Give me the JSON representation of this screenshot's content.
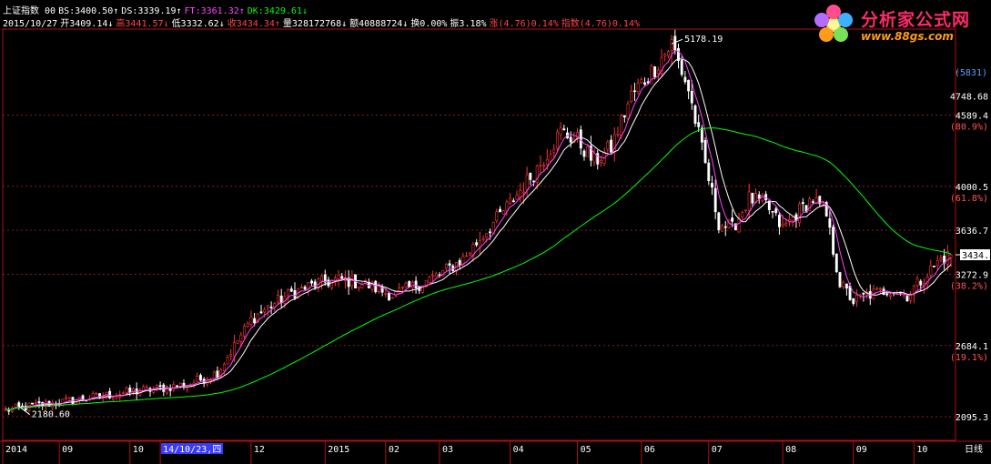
{
  "header": {
    "line1": [
      {
        "label": "上证指数 00",
        "value": "",
        "color": "#ffffff"
      },
      {
        "label": "BS:",
        "value": "3400.50↑",
        "color": "#ffffff"
      },
      {
        "label": "DS:",
        "value": "3339.19↑",
        "color": "#ffffff"
      },
      {
        "label": "FT:",
        "value": "3361.32↑",
        "color": "#ff44ff"
      },
      {
        "label": "DK:",
        "value": "3429.61↓",
        "color": "#00ff00"
      }
    ],
    "line2": [
      {
        "label": "2015/10/27",
        "value": "",
        "color": "#ffffff"
      },
      {
        "label": "开",
        "value": "3409.14↓",
        "color": "#ffffff"
      },
      {
        "label": "高",
        "value": "3441.57↓",
        "color": "#ff4444"
      },
      {
        "label": "低",
        "value": "3332.62↓",
        "color": "#ffffff"
      },
      {
        "label": "收",
        "value": "3434.34↑",
        "color": "#ff4444"
      },
      {
        "label": "量",
        "value": "328172768↓",
        "color": "#ffffff"
      },
      {
        "label": "额",
        "value": "40888724↓",
        "color": "#ffffff"
      },
      {
        "label": "换",
        "value": "0.00%",
        "color": "#ffffff"
      },
      {
        "label": "振",
        "value": "3.18%",
        "color": "#ffffff"
      },
      {
        "label": "涨",
        "value": "(4.76)0.14%",
        "color": "#ff4444"
      },
      {
        "label": "指数",
        "value": "(4.76)0.14%",
        "color": "#ff4444"
      }
    ]
  },
  "logo": {
    "title": "分析家公式网",
    "url": "www.88gs.com"
  },
  "colors": {
    "background": "#000000",
    "frame": "#b01010",
    "grid": "#8b1a1a",
    "candle_up": "#ff3333",
    "candle_down": "#ffffff",
    "ma_fast": "#ffffff",
    "ma_mid": "#ff44ff",
    "ma_long": "#00ff00",
    "axis_text": "#ffffff",
    "percent_text": "#ff5555",
    "highlight_box": "#3a3aff"
  },
  "chart_data": {
    "type": "line",
    "title": "",
    "series_note": "上证指数 daily candlesticks with moving averages",
    "xlabel": "",
    "ylabel": "",
    "ylim": [
      1900,
      5300
    ],
    "grid": true,
    "y_ticks": [
      {
        "value": 5831,
        "label": "(5831)",
        "percent": ""
      },
      {
        "value": 4748.68,
        "label": "4748.68",
        "percent": ""
      },
      {
        "value": 4589.4,
        "label": "4589.4",
        "percent": "(80.9%)"
      },
      {
        "value": 4000.5,
        "label": "4000.5",
        "percent": "(61.8%)"
      },
      {
        "value": 3636.7,
        "label": "3636.7",
        "percent": ""
      },
      {
        "value": 3272.9,
        "label": "3272.9",
        "percent": "(38.2%)"
      },
      {
        "value": 2684.1,
        "label": "2684.1",
        "percent": "(19.1%)"
      },
      {
        "value": 2095.3,
        "label": "2095.3",
        "percent": ""
      }
    ],
    "current_price_label": "3434.3",
    "current_price": 3434.34,
    "x_ticks": [
      {
        "label": "2014",
        "index": 0
      },
      {
        "label": "09",
        "index": 16
      },
      {
        "label": "10",
        "index": 37
      },
      {
        "label": "14/10/23,四",
        "index": 46,
        "highlight": true
      },
      {
        "label": "12",
        "index": 73
      },
      {
        "label": "2015",
        "index": 95
      },
      {
        "label": "02",
        "index": 113
      },
      {
        "label": "03",
        "index": 129
      },
      {
        "label": "04",
        "index": 150
      },
      {
        "label": "05",
        "index": 170
      },
      {
        "label": "06",
        "index": 189
      },
      {
        "label": "07",
        "index": 209
      },
      {
        "label": "08",
        "index": 231
      },
      {
        "label": "09",
        "index": 252
      },
      {
        "label": "10",
        "index": 270
      }
    ],
    "x_end_label": "日线",
    "n_bars": 282,
    "anchors": [
      [
        0,
        2150
      ],
      [
        12,
        2200
      ],
      [
        22,
        2240
      ],
      [
        37,
        2300
      ],
      [
        46,
        2330
      ],
      [
        55,
        2370
      ],
      [
        63,
        2460
      ],
      [
        68,
        2680
      ],
      [
        73,
        2900
      ],
      [
        78,
        3000
      ],
      [
        85,
        3120
      ],
      [
        93,
        3200
      ],
      [
        100,
        3230
      ],
      [
        108,
        3180
      ],
      [
        115,
        3100
      ],
      [
        122,
        3180
      ],
      [
        129,
        3270
      ],
      [
        136,
        3400
      ],
      [
        142,
        3600
      ],
      [
        150,
        3860
      ],
      [
        158,
        4150
      ],
      [
        165,
        4450
      ],
      [
        170,
        4380
      ],
      [
        175,
        4200
      ],
      [
        180,
        4320
      ],
      [
        186,
        4750
      ],
      [
        192,
        4950
      ],
      [
        198,
        5178
      ],
      [
        203,
        4800
      ],
      [
        207,
        4300
      ],
      [
        212,
        3700
      ],
      [
        216,
        3650
      ],
      [
        221,
        3900
      ],
      [
        226,
        3850
      ],
      [
        231,
        3650
      ],
      [
        236,
        3800
      ],
      [
        240,
        3900
      ],
      [
        244,
        3750
      ],
      [
        248,
        3200
      ],
      [
        252,
        3050
      ],
      [
        256,
        3100
      ],
      [
        263,
        3150
      ],
      [
        268,
        3100
      ],
      [
        273,
        3250
      ],
      [
        278,
        3400
      ],
      [
        281,
        3434
      ]
    ],
    "annotations": [
      {
        "text": "5178.19",
        "kind": "high",
        "index": 198,
        "value": 5178.19
      },
      {
        "text": "2180.60",
        "kind": "low",
        "index": 4,
        "value": 2180.6
      }
    ],
    "last_bar": {
      "date": "2015/10/27",
      "open": 3409.14,
      "high": 3441.57,
      "low": 3332.62,
      "close": 3434.34
    }
  }
}
